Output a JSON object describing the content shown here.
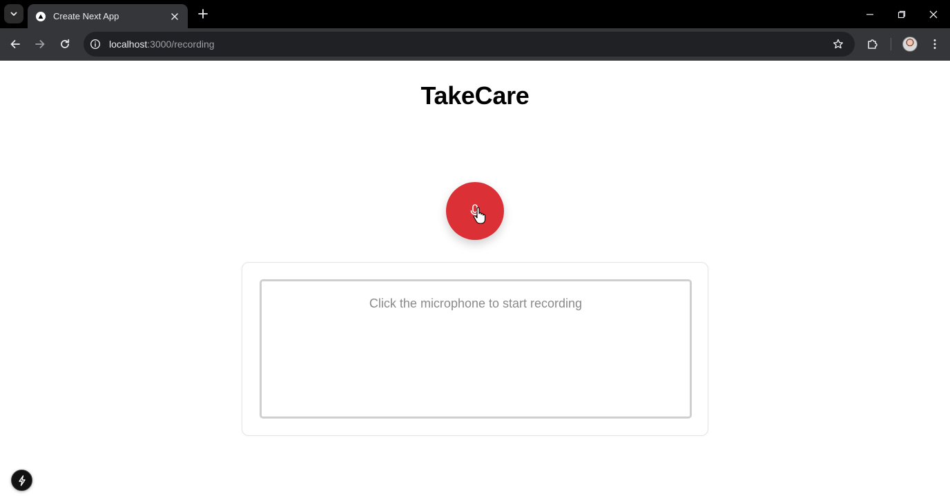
{
  "browser": {
    "tab_title": "Create Next App",
    "url_host": "localhost",
    "url_path": ":3000/recording"
  },
  "app": {
    "title": "TakeCare"
  },
  "recorder": {
    "mic_icon": "microphone-icon",
    "button_color": "#dc3037",
    "status_text": "Click the microphone to start recording"
  },
  "icons": {
    "tab_search": "chevron-down-icon",
    "favicon": "triangle-icon",
    "close": "close-icon",
    "new_tab": "plus-icon",
    "back": "arrow-left-icon",
    "forward": "arrow-right-icon",
    "reload": "reload-icon",
    "site_info": "info-icon",
    "bookmark": "star-icon",
    "extensions": "puzzle-icon",
    "menu": "kebab-menu-icon",
    "dev_indicator": "lightning-icon"
  }
}
